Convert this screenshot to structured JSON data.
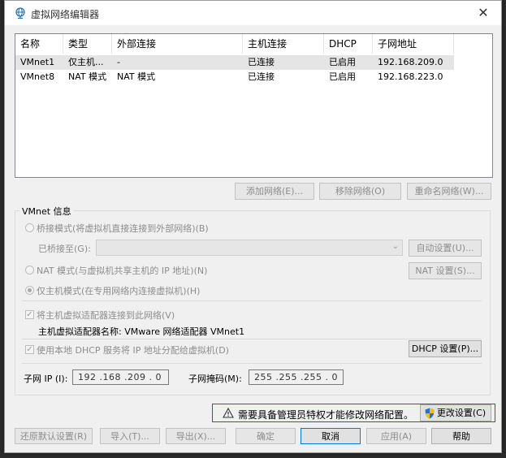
{
  "window": {
    "title": "虚拟网络编辑器",
    "close_glyph": "✕"
  },
  "netlist": {
    "columns": [
      "名称",
      "类型",
      "外部连接",
      "主机连接",
      "DHCP",
      "子网地址"
    ],
    "rows": [
      [
        "VMnet1",
        "仅主机...",
        "-",
        "已连接",
        "已启用",
        "192.168.209.0"
      ],
      [
        "VMnet8",
        "NAT 模式",
        "NAT 模式",
        "已连接",
        "已启用",
        "192.168.223.0"
      ]
    ]
  },
  "list_buttons": {
    "add": "添加网络(E)...",
    "remove": "移除网络(O)",
    "rename": "重命名网络(W)..."
  },
  "info": {
    "title": "VMnet 信息",
    "bridge_mode": "桥接模式(将虚拟机直接连接到外部网络)(B)",
    "bridged_to": "已桥接至(G):",
    "auto_settings": "自动设置(U)...",
    "nat_mode": "NAT 模式(与虚拟机共享主机的 IP 地址)(N)",
    "nat_settings": "NAT 设置(S)...",
    "host_only_mode": "仅主机模式(在专用网络内连接虚拟机)(H)",
    "connect_adapter": "将主机虚拟适配器连接到此网络(V)",
    "adapter_name": "主机虚拟适配器名称: VMware 网络适配器 VMnet1",
    "use_dhcp": "使用本地 DHCP 服务将 IP 地址分配给虚拟机(D)",
    "dhcp_settings": "DHCP 设置(P)...",
    "subnet_ip_label": "子网 IP (I):",
    "subnet_ip": "192 .168 .209 . 0",
    "subnet_mask_label": "子网掩码(M):",
    "subnet_mask": "255 .255 .255 . 0",
    "checkmark": "✓"
  },
  "warning": {
    "text": "需要具备管理员特权才能修改网络配置。",
    "change_settings": "更改设置(C)"
  },
  "footer": {
    "restore": "还原默认设置(R)",
    "import": "导入(T)...",
    "export": "导出(X)...",
    "ok": "确定",
    "cancel": "取消",
    "apply": "应用(A)",
    "help": "帮助"
  },
  "colors": {
    "warning_border": "#e81123",
    "primary_border": "#0078d7",
    "selected_row": "#e5e5e5"
  }
}
